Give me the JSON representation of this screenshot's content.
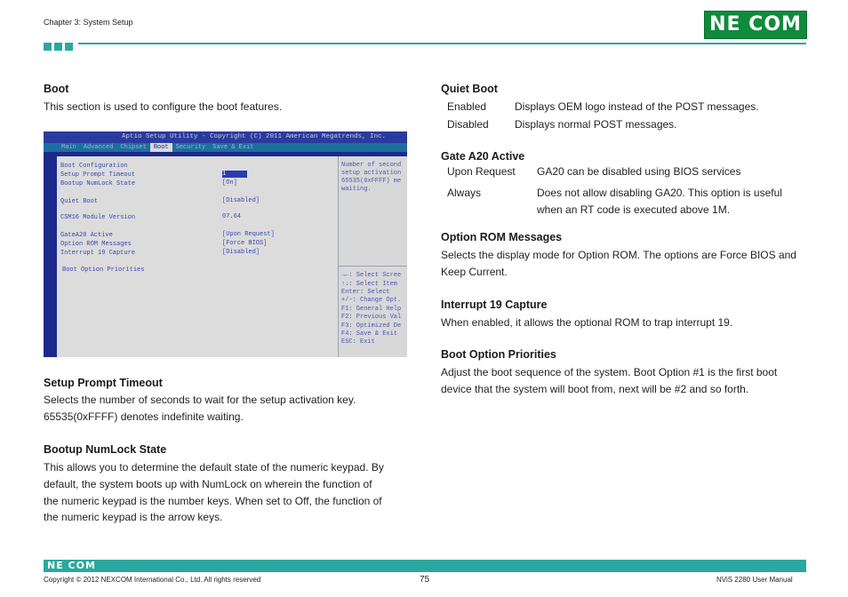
{
  "header": {
    "chapter": "Chapter 3: System Setup",
    "logo": "NE COM"
  },
  "left": {
    "boot_title": "Boot",
    "boot_desc": "This section is used to configure the boot features.",
    "bios": {
      "title": "Aptio Setup Utility - Copyright (C) 2011 American Megatrends, Inc.",
      "tabs": [
        "Main",
        "Advanced",
        "Chipset",
        "Boot",
        "Security",
        "Save & Exit"
      ],
      "items": [
        {
          "label": "Boot Configuration",
          "value": ""
        },
        {
          "label": "Setup Prompt Timeout",
          "value": "1"
        },
        {
          "label": "Bootup NumLock State",
          "value": "[On]"
        },
        {
          "label": "Quiet Boot",
          "value": "[Disabled]"
        },
        {
          "label": "CSM16 Module Version",
          "value": "07.64"
        },
        {
          "label": "GateA20 Active",
          "value": "[Upon Request]"
        },
        {
          "label": "Option ROM Messages",
          "value": "[Force BIOS]"
        },
        {
          "label": "Interrupt 19 Capture",
          "value": "[Disabled]"
        },
        {
          "label": "Boot Option Priorities",
          "value": ""
        }
      ],
      "help_top": [
        "Number of second",
        "setup activation",
        "65535(0xFFFF) me",
        "waiting."
      ],
      "help_keys": [
        "→←: Select Scree",
        "↑↓: Select Item",
        "Enter: Select",
        "+/-: Change Opt.",
        "F1: General Help",
        "F2: Previous Val",
        "F3: Optimized De",
        "F4: Save & Exit",
        "ESC: Exit"
      ]
    },
    "setup_title": "Setup Prompt Timeout",
    "setup_lines": [
      "Selects the number of seconds to wait for the setup activation key.",
      "65535(0xFFFF) denotes indefinite waiting."
    ],
    "numlock_title": "Bootup NumLock State",
    "numlock_lines": [
      "This allows you to determine the default state of the numeric keypad. By",
      "default, the system boots up with NumLock on wherein the function of",
      "the numeric keypad is the number keys. When set to Off, the function of",
      "the numeric keypad is the arrow keys."
    ]
  },
  "right": {
    "quiet_title": "Quiet Boot",
    "quiet_rows": [
      {
        "term": "Enabled",
        "desc": "Displays OEM logo instead of the POST messages."
      },
      {
        "term": "Disabled",
        "desc": "Displays normal POST messages."
      }
    ],
    "gate_title": "Gate A20 Active",
    "gate_rows": [
      {
        "term": "Upon Request",
        "desc1": "GA20 can be disabled using BIOS services",
        "desc2": ""
      },
      {
        "term": "Always",
        "desc1": "Does not allow disabling GA20. This option is useful",
        "desc2": "when an RT code is executed above 1M."
      }
    ],
    "optrom_title": "Option ROM Messages",
    "optrom_lines": [
      "Selects the display mode for Option ROM. The options are Force BIOS and",
      "Keep Current."
    ],
    "int19_title": "Interrupt 19 Capture",
    "int19_desc": "When enabled, it allows the optional ROM to trap interrupt 19.",
    "bop_title": "Boot Option Priorities",
    "bop_lines": [
      "Adjust the boot sequence of the system. Boot Option #1 is the first boot",
      "device that the system will boot from, next will be #2 and so forth."
    ]
  },
  "footer": {
    "logo": "NE COM",
    "copyright": "Copyright © 2012 NEXCOM International Co., Ltd. All rights reserved",
    "page": "75",
    "manual": "NViS 2280 User Manual"
  },
  "colors": {
    "accent": "#2aa8a0",
    "logo_green": "#0f8b3c",
    "bios_blue": "#1b2a8a"
  }
}
